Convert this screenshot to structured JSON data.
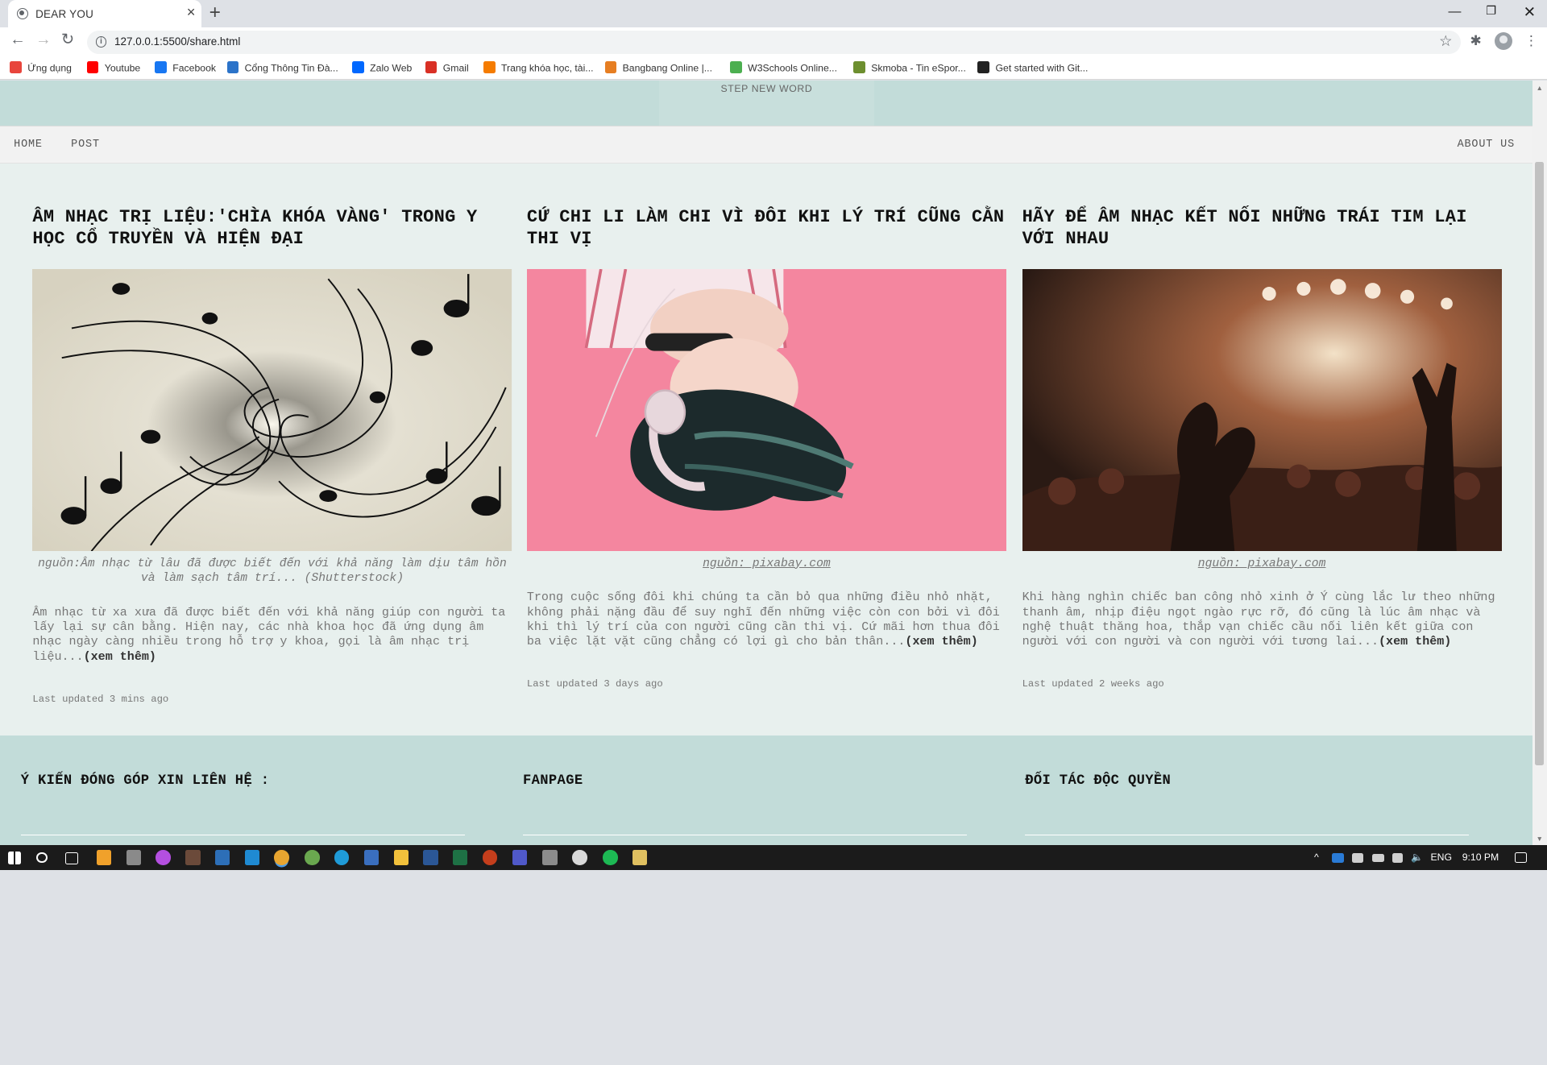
{
  "browser": {
    "tab_title": "DEAR YOU",
    "url": "127.0.0.1:5500/share.html",
    "bookmarks": [
      {
        "label": "Ứng dụng",
        "icon": "apps-grid-icon",
        "color": "#e8453c"
      },
      {
        "label": "Youtube",
        "icon": "youtube-icon",
        "color": "#ff0000"
      },
      {
        "label": "Facebook",
        "icon": "facebook-icon",
        "color": "#1877f2"
      },
      {
        "label": "Cổng Thông Tin Đà...",
        "icon": "portal-icon",
        "color": "#2b73c9"
      },
      {
        "label": "Zalo Web",
        "icon": "zalo-icon",
        "color": "#0068ff"
      },
      {
        "label": "Gmail",
        "icon": "gmail-icon",
        "color": "#d93025"
      },
      {
        "label": "Trang khóa học, tài...",
        "icon": "course-icon",
        "color": "#f57c00"
      },
      {
        "label": "Bangbang Online |...",
        "icon": "bangbang-icon",
        "color": "#e67e22"
      },
      {
        "label": "W3Schools Online...",
        "icon": "w3schools-icon",
        "color": "#4caf50"
      },
      {
        "label": "Skmoba - Tin eSpor...",
        "icon": "skmoba-icon",
        "color": "#6d8f2f"
      },
      {
        "label": "Get started with Git...",
        "icon": "github-icon",
        "color": "#222222"
      }
    ]
  },
  "site": {
    "logo_text": "STEP NEW WORD",
    "nav": {
      "home": "HOME",
      "post": "POST",
      "about": "ABOUT US"
    },
    "posts": [
      {
        "title": "ÂM NHẠC TRỊ LIỆU:'CHÌA KHÓA VÀNG' TRONG Y HỌC CỔ TRUYỀN VÀ HIỆN ĐẠI",
        "image": "music-notes-spiral",
        "caption": "nguồn:Âm nhạc từ lâu đã được biết đến với khả năng làm dịu tâm hồn và làm sạch tâm trí... (Shutterstock)",
        "excerpt": "Âm nhạc từ xa xưa đã được biết đến với khả năng giúp con người ta lấy lại sự cân bằng. Hiện nay, các nhà khoa học đã ứng dụng âm nhạc ngày càng nhiều trong hỗ trợ y khoa, gọi là âm nhạc trị liệu...",
        "more": "(xem thêm)",
        "updated": "Last updated 3 mins ago"
      },
      {
        "title": "CỨ CHI LI LÀM CHI VÌ ĐÔI KHI LÝ TRÍ CŨNG CẰN THI VỊ",
        "image": "girl-with-headphones-pink",
        "caption": "nguồn: pixabay.com",
        "excerpt": "Trong cuộc sống đôi khi chúng ta cần bỏ qua những điều nhỏ nhặt, không phải nặng đầu để suy nghĩ đến những việc còn con bởi vì đôi khi thì lý trí của con người cũng cần thi vị. Cứ mãi hơn thua đôi ba việc lặt vặt cũng chẳng có lợi gì cho bản thân...",
        "more": "(xem thêm)",
        "updated": "Last updated 3 days ago"
      },
      {
        "title": "HÃY ĐỂ ÂM NHẠC KẾT NỐI NHỮNG TRÁI TIM LẠI VỚI NHAU",
        "image": "concert-crowd-heart-hands",
        "caption": "nguồn: pixabay.com",
        "excerpt": "Khi hàng nghìn chiếc ban công nhỏ xinh ở Ý cùng lắc lư theo những thanh âm, nhịp điệu ngọt ngào rực rỡ, đó cũng là lúc âm nhạc và nghệ thuật thăng hoa, thắp vạn chiếc cầu nối liên kết giữa con người với con người và con người với tương lai...",
        "more": "(xem thêm)",
        "updated": "Last updated 2 weeks ago"
      }
    ],
    "footer": {
      "contact": "Ý KIẾN ĐÓNG GÓP XIN LIÊN HỆ :",
      "fanpage": "FANPAGE",
      "partner": "ĐỐI TÁC ĐỘC QUYỀN"
    }
  },
  "taskbar": {
    "lang": "ENG",
    "time": "9:10 PM"
  }
}
